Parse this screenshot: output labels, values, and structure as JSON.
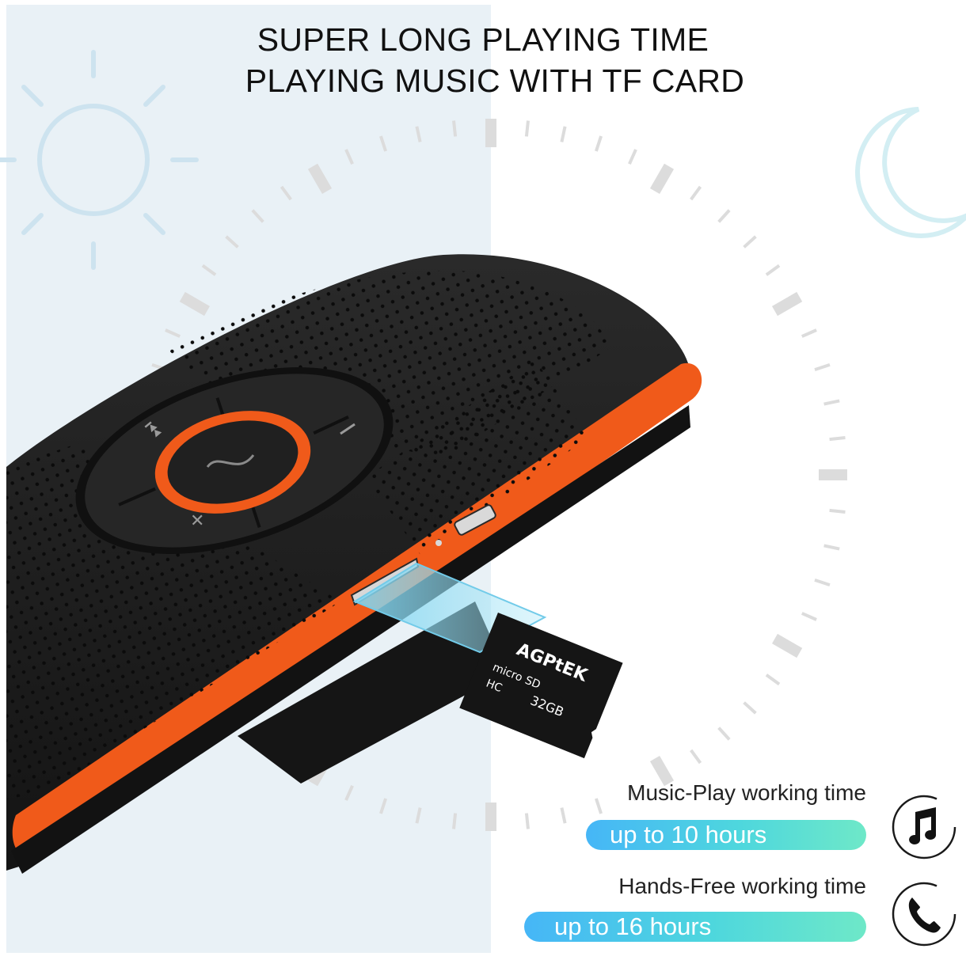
{
  "headline": {
    "line1": "SUPER LONG PLAYING TIME",
    "line2": "PLAYING MUSIC WITH TF CARD"
  },
  "features": [
    {
      "title": "Music-Play working time",
      "value": "up to 10 hours",
      "icon": "music-note-icon"
    },
    {
      "title": "Hands-Free working time",
      "value": "up to 16 hours",
      "icon": "phone-icon"
    }
  ],
  "sd_card": {
    "brand": "AGPtEK",
    "capacity": "32GB",
    "labels": [
      "micro",
      "SD",
      "HC"
    ]
  },
  "colors": {
    "accent_orange": "#f05a1a",
    "device_body": "#1e1e1e",
    "pill_gradient_start": "#46b6f7",
    "pill_gradient_end": "#6ee8c8",
    "left_panel": "#e9f1f6",
    "clock_marks": "#dcdcdc",
    "sun_moon_lines": "#c9e1ee"
  }
}
